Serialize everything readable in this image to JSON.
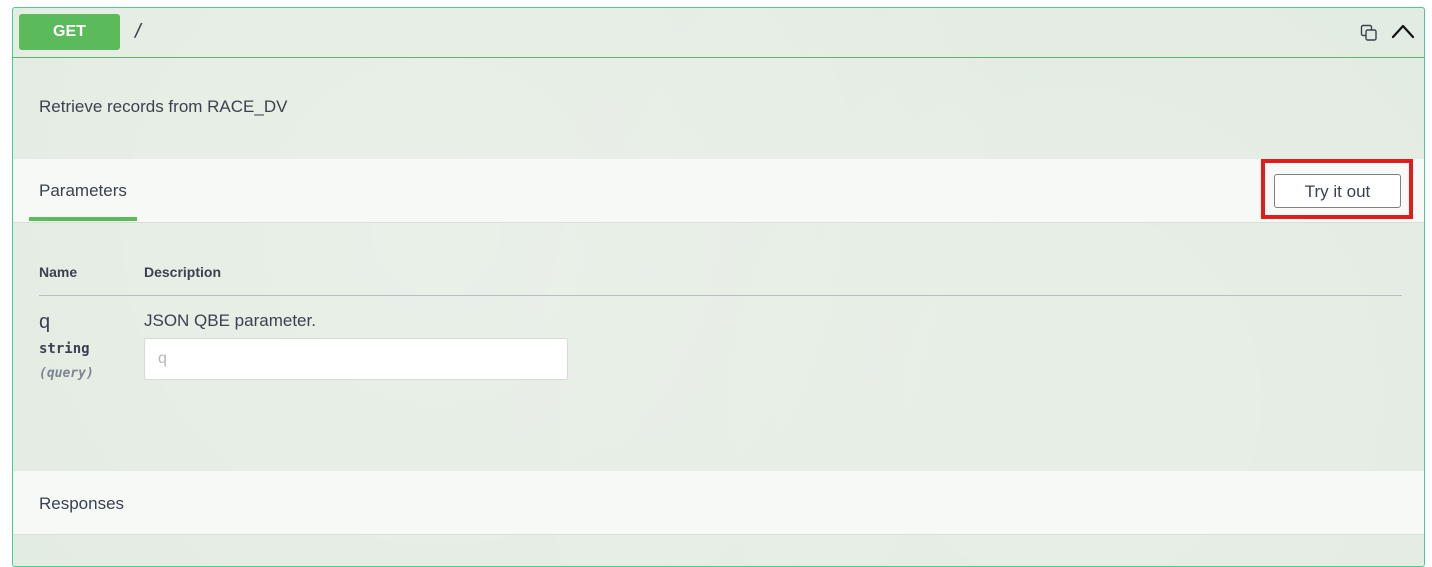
{
  "operation": {
    "method": "GET",
    "path": "/",
    "description": "Retrieve records from RACE_DV",
    "copy_icon": "copy-icon",
    "collapse_icon": "chevron-up-icon",
    "accent_color": "#5bba59"
  },
  "parameters": {
    "tab_label": "Parameters",
    "try_button_label": "Try it out",
    "highlight_color": "#e21b1b",
    "columns": {
      "name": "Name",
      "description": "Description"
    },
    "rows": [
      {
        "name": "q",
        "type": "string",
        "in": "(query)",
        "description": "JSON QBE parameter.",
        "placeholder": "q",
        "value": ""
      }
    ]
  },
  "responses": {
    "label": "Responses"
  }
}
